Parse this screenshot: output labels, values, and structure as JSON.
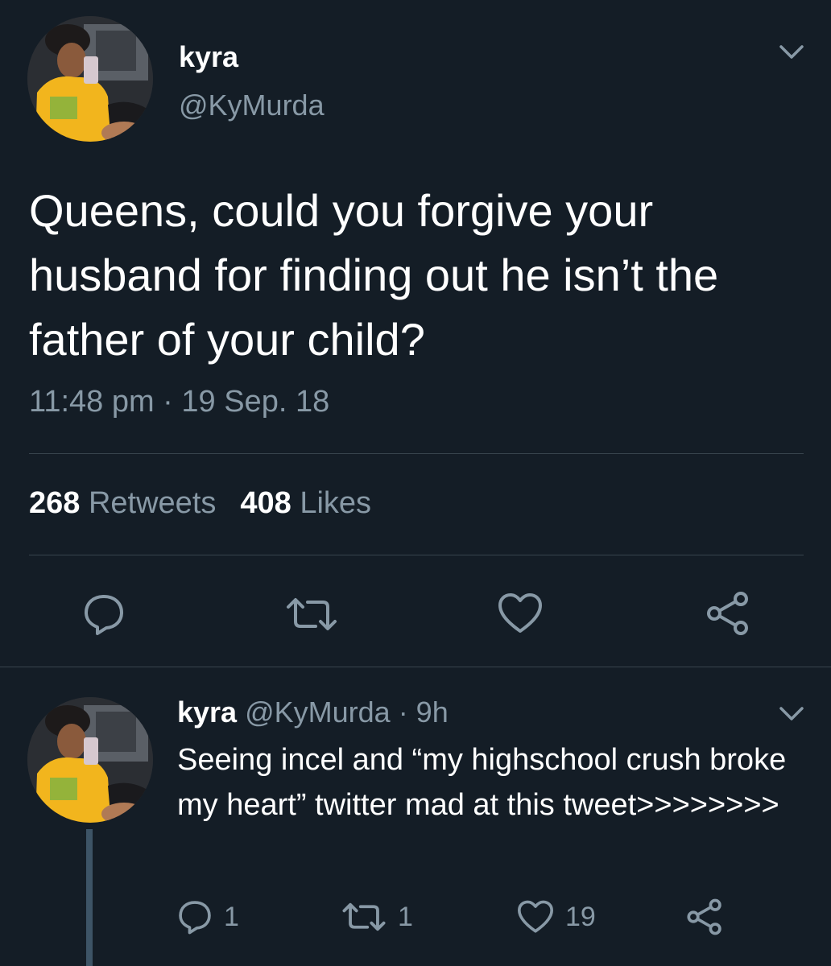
{
  "main_tweet": {
    "name": "kyra",
    "handle": "@KyMurda",
    "text": "Queens, could you forgive your husband for finding out he isn’t the father of your child?",
    "timestamp": "11:48 pm · 19 Sep. 18",
    "retweets_count": "268",
    "retweets_label": "Retweets",
    "likes_count": "408",
    "likes_label": "Likes"
  },
  "reply_tweet": {
    "name": "kyra",
    "handle_time": "@KyMurda · 9h",
    "text": "Seeing incel and “my highschool crush broke my heart” twitter mad at this tweet>>>>>>>>",
    "reply_count": "1",
    "retweet_count": "1",
    "like_count": "19"
  },
  "colors": {
    "background": "#141d26",
    "secondary_text": "#8899a6",
    "divider": "#38444d",
    "thread_line": "#3d5466"
  },
  "icons": [
    "chevron-down-icon",
    "reply-icon",
    "retweet-icon",
    "heart-icon",
    "share-icon"
  ]
}
